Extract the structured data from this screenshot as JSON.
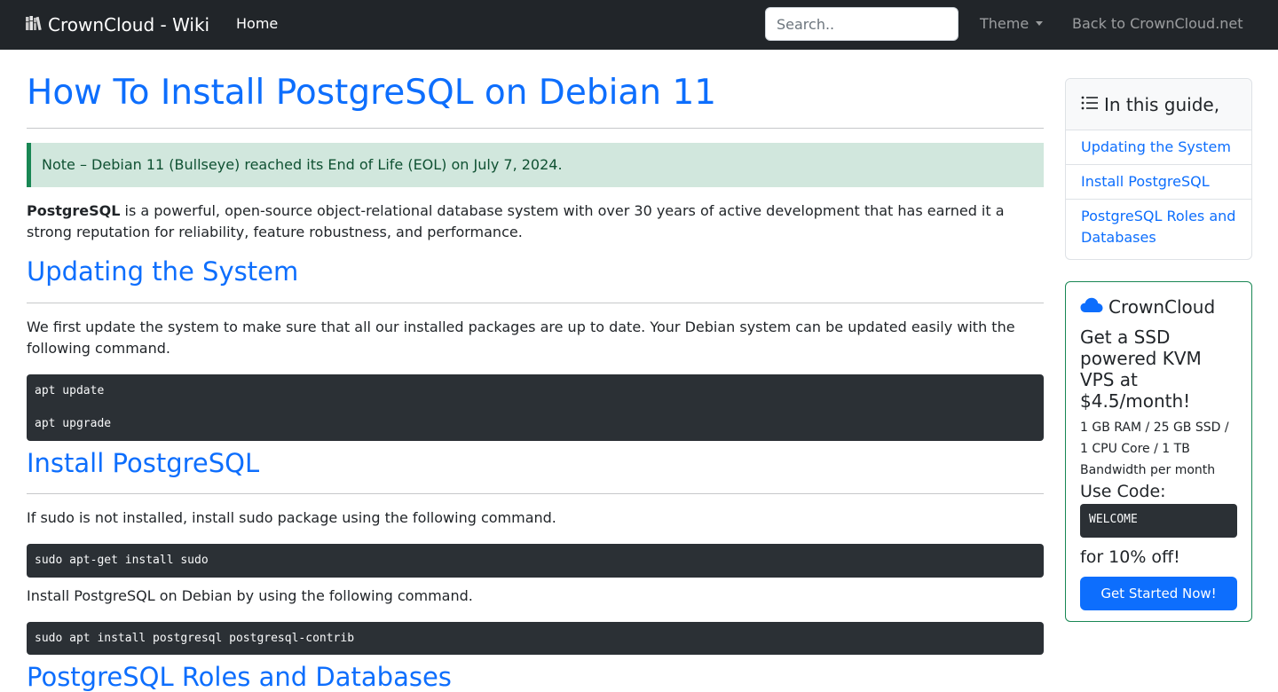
{
  "navbar": {
    "brand": "CrownCloud - Wiki",
    "brand_icon": "books-icon",
    "home": "Home",
    "search_placeholder": "Search..",
    "theme": "Theme",
    "back": "Back to CrownCloud.net"
  },
  "article": {
    "title": "How To Install PostgreSQL on Debian 11",
    "note": "Note – Debian 11 (Bullseye) reached its End of Life (EOL) on July 7, 2024.",
    "intro_bold": "PostgreSQL",
    "intro_rest": " is a powerful, open-source object-relational database system with over 30 years of active development that has earned it a strong reputation for reliability, feature robustness, and performance.",
    "sections": [
      {
        "heading": "Updating the System",
        "text": "We first update the system to make sure that all our installed packages are up to date. Your Debian system can be updated easily with the following command.",
        "code": "apt update\n\napt upgrade"
      },
      {
        "heading": "Install PostgreSQL",
        "text": "If sudo is not installed, install sudo package using the following command.",
        "code": "sudo apt-get install sudo",
        "text2": "Install PostgreSQL on Debian by using the following command.",
        "code2": "sudo apt install postgresql postgresql-contrib"
      },
      {
        "heading": "PostgreSQL Roles and Databases"
      }
    ]
  },
  "toc": {
    "heading": "In this guide,",
    "items": [
      "Updating the System",
      "Install PostgreSQL",
      "PostgreSQL Roles and Databases"
    ]
  },
  "promo": {
    "brand": "CrownCloud",
    "offer": "Get a SSD powered KVM VPS at $4.5/month!",
    "specs": "1 GB RAM / 25 GB SSD / 1 CPU Core / 1 TB Bandwidth per month",
    "code_label": "Use Code:",
    "code": "WELCOME",
    "discount": "for 10% off!",
    "button": "Get Started Now!"
  },
  "colors": {
    "navbar_bg": "#212529",
    "link": "#0d6efd",
    "note_bg": "#d1e7dd",
    "note_border": "#198754",
    "code_bg": "#2b3035"
  }
}
